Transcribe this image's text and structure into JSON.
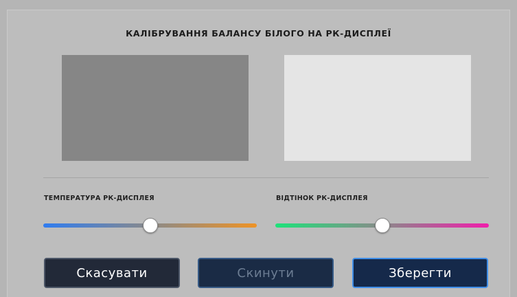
{
  "dialog": {
    "title": "КАЛІБРУВАННЯ БАЛАНСУ БІЛОГО НА РК-ДИСПЛЕЇ"
  },
  "swatches": {
    "left_color": "#868686",
    "right_color": "#e5e5e5"
  },
  "sliders": {
    "temperature": {
      "label": "ТЕМПЕРАТУРА РК-ДИСПЛЕЯ",
      "value": 0.5,
      "gradient_start": "#2f7cf0",
      "gradient_end": "#ee9326"
    },
    "tint": {
      "label": "ВІДТІНОК РК-ДИСПЛЕЯ",
      "value": 0.5,
      "gradient_start": "#1de27a",
      "gradient_end": "#f01eab"
    }
  },
  "buttons": {
    "cancel_label": "Скасувати",
    "reset_label": "Скинути",
    "save_label": "Зберегти"
  }
}
